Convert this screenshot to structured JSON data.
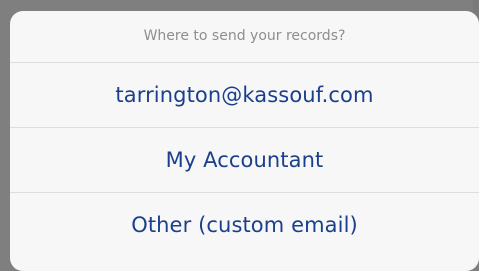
{
  "action_sheet": {
    "title": "Where to send your records?",
    "options": [
      {
        "label": "tarrington@kassouf.com"
      },
      {
        "label": "My Accountant"
      },
      {
        "label": "Other (custom email)"
      }
    ],
    "colors": {
      "option_text": "#1a3f8c",
      "title_text": "#8e8e8e",
      "sheet_background": "#f7f7f7",
      "divider": "#dddddd",
      "backdrop": "#7f7f7f"
    }
  }
}
